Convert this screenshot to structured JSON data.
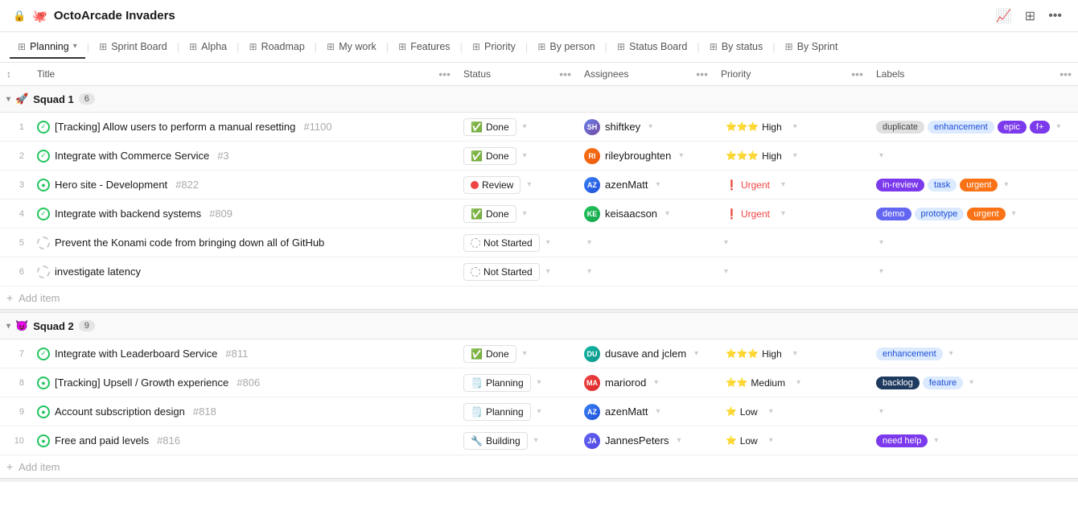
{
  "header": {
    "lock_icon": "🔒",
    "emoji": "🐙",
    "title": "OctoArcade Invaders",
    "actions": [
      "📈",
      "⊞",
      "..."
    ]
  },
  "tabs": [
    {
      "label": "Planning",
      "icon": "⊞",
      "active": true,
      "has_dropdown": true
    },
    {
      "label": "Sprint Board",
      "icon": "⊞",
      "active": false
    },
    {
      "label": "Alpha",
      "icon": "⊞",
      "active": false
    },
    {
      "label": "Roadmap",
      "icon": "⊞",
      "active": false
    },
    {
      "label": "My work",
      "icon": "⊞",
      "active": false
    },
    {
      "label": "Features",
      "icon": "⊞",
      "active": false
    },
    {
      "label": "Priority",
      "icon": "⊞",
      "active": false
    },
    {
      "label": "By person",
      "icon": "⊞",
      "active": false
    },
    {
      "label": "Status Board",
      "icon": "⊞",
      "active": false
    },
    {
      "label": "By status",
      "icon": "⊞",
      "active": false
    },
    {
      "label": "By Sprint",
      "icon": "⊞",
      "active": false
    }
  ],
  "columns": [
    {
      "label": "Title",
      "name": "title"
    },
    {
      "label": "Status",
      "name": "status"
    },
    {
      "label": "Assignees",
      "name": "assignees"
    },
    {
      "label": "Priority",
      "name": "priority"
    },
    {
      "label": "Labels",
      "name": "labels"
    }
  ],
  "groups": [
    {
      "id": "squad1",
      "name": "Squad 1",
      "emoji": "🚀",
      "count": 6,
      "rows": [
        {
          "num": 1,
          "title": "[Tracking] Allow users to perform a manual resetting",
          "task_id": "#1100",
          "status": "Done ✅",
          "status_type": "done",
          "assignee": "shiftkey",
          "avatar_color": "purple",
          "priority": "High",
          "priority_stars": "⭐⭐⭐",
          "priority_type": "high",
          "labels": [
            "duplicate",
            "enhancement",
            "epic",
            "f+"
          ]
        },
        {
          "num": 2,
          "title": "Integrate with Commerce Service",
          "task_id": "#3",
          "status": "Done ✅",
          "status_type": "done",
          "assignee": "rileybroughten",
          "avatar_color": "orange",
          "priority": "High",
          "priority_stars": "⭐⭐⭐",
          "priority_type": "high",
          "labels": []
        },
        {
          "num": 3,
          "title": "Hero site - Development",
          "task_id": "#822",
          "status": "Review 🔴",
          "status_type": "review",
          "assignee": "azenMatt",
          "avatar_color": "blue",
          "priority": "Urgent",
          "priority_type": "urgent",
          "labels": [
            "in-review",
            "task",
            "urgent"
          ]
        },
        {
          "num": 4,
          "title": "Integrate with backend systems",
          "task_id": "#809",
          "status": "Done ✅",
          "status_type": "done",
          "assignee": "keisaacson",
          "avatar_color": "green",
          "priority": "Urgent",
          "priority_type": "urgent",
          "labels": [
            "demo",
            "prototype",
            "urgent"
          ]
        },
        {
          "num": 5,
          "title": "Prevent the Konami code from bringing down all of GitHub",
          "task_id": "",
          "status": "Not Started 🕐",
          "status_type": "not-started",
          "assignee": "",
          "avatar_color": "",
          "priority": "",
          "priority_type": "",
          "labels": []
        },
        {
          "num": 6,
          "title": "investigate latency",
          "task_id": "",
          "status": "Not Started 🕐",
          "status_type": "not-started",
          "assignee": "",
          "avatar_color": "",
          "priority": "",
          "priority_type": "",
          "labels": []
        }
      ]
    },
    {
      "id": "squad2",
      "name": "Squad 2",
      "emoji": "😈",
      "count": 9,
      "rows": [
        {
          "num": 7,
          "title": "Integrate with Leaderboard Service",
          "task_id": "#811",
          "status": "Done ✅",
          "status_type": "done",
          "assignee": "dusave and jclem",
          "avatar_color": "teal",
          "priority": "High",
          "priority_stars": "⭐⭐⭐",
          "priority_type": "high",
          "labels": [
            "enhancement"
          ]
        },
        {
          "num": 8,
          "title": "[Tracking] Upsell / Growth experience",
          "task_id": "#806",
          "status": "Planning 📋",
          "status_type": "planning",
          "assignee": "mariorod",
          "avatar_color": "red",
          "priority": "Medium",
          "priority_stars": "⭐⭐",
          "priority_type": "medium",
          "labels": [
            "backlog",
            "feature"
          ]
        },
        {
          "num": 9,
          "title": "Account subscription design",
          "task_id": "#818",
          "status": "Planning 📋",
          "status_type": "planning",
          "assignee": "azenMatt",
          "avatar_color": "blue",
          "priority": "Low",
          "priority_stars": "⭐",
          "priority_type": "low",
          "labels": []
        },
        {
          "num": 10,
          "title": "Free and paid levels",
          "task_id": "#816",
          "status": "Building 🔧",
          "status_type": "building",
          "assignee": "JannesPeters",
          "avatar_color": "indigo",
          "priority": "Low",
          "priority_stars": "⭐",
          "priority_type": "low",
          "labels": [
            "need help"
          ]
        }
      ]
    }
  ],
  "add_item_label": "Add item"
}
